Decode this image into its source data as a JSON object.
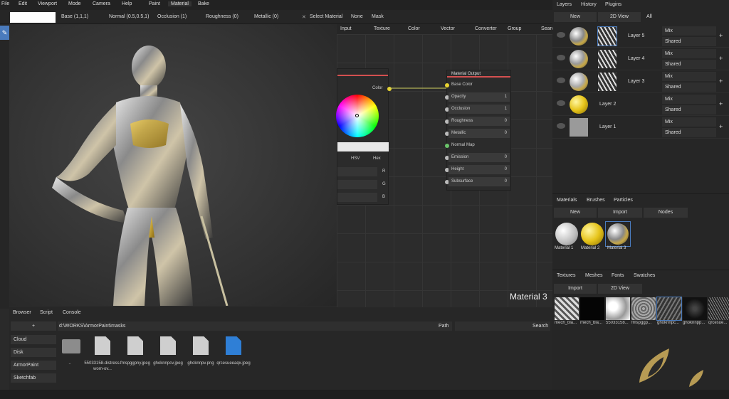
{
  "menu": {
    "items": [
      "File",
      "Edit",
      "Viewport",
      "Mode",
      "Camera",
      "Help"
    ],
    "tabs": [
      "Paint",
      "Material",
      "Bake"
    ]
  },
  "toolbar": {
    "base": "Base (1,1,1)",
    "normal": "Normal (0.5,0.5,1)",
    "occlusion": "Occlusion (1)",
    "roughness": "Roughness (0)",
    "metallic": "Metallic (0)",
    "select_material": "Select Material",
    "none": "None",
    "mask": "Mask"
  },
  "node_menu": [
    "Input",
    "Texture",
    "Color",
    "Vector",
    "Converter",
    "Group",
    "Search"
  ],
  "picker": {
    "color_label": "Color",
    "hsv": "HSV",
    "hex": "Hex",
    "r": "R",
    "g": "G",
    "b": "B"
  },
  "material_output": {
    "title": "Material Output",
    "rows": [
      {
        "label": "Base Color",
        "value": ""
      },
      {
        "label": "Opacity",
        "value": "1"
      },
      {
        "label": "Occlusion",
        "value": "1"
      },
      {
        "label": "Roughness",
        "value": "0"
      },
      {
        "label": "Metallic",
        "value": "0"
      },
      {
        "label": "Normal Map",
        "value": ""
      },
      {
        "label": "Emission",
        "value": "0"
      },
      {
        "label": "Height",
        "value": "0"
      },
      {
        "label": "Subsurface",
        "value": "0"
      }
    ]
  },
  "viewport_label": "Material 3",
  "layers_panel": {
    "tabs": [
      "Layers",
      "History",
      "Plugins"
    ],
    "buttons": {
      "new": "New",
      "view2d": "2D View",
      "all": "All"
    },
    "layers": [
      {
        "name": "Layer 5",
        "mode": "Mix",
        "shared": "Shared"
      },
      {
        "name": "Layer 4",
        "mode": "Mix",
        "shared": "Shared"
      },
      {
        "name": "Layer 3",
        "mode": "Mix",
        "shared": "Shared"
      },
      {
        "name": "Layer 2",
        "mode": "Mix",
        "shared": "Shared"
      },
      {
        "name": "Layer 1",
        "mode": "Mix",
        "shared": "Shared"
      }
    ]
  },
  "materials_panel": {
    "tabs": [
      "Materials",
      "Brushes",
      "Particles"
    ],
    "buttons": {
      "new": "New",
      "import": "Import",
      "nodes": "Nodes"
    },
    "items": [
      "Material 1",
      "Material 2",
      "Material 3"
    ]
  },
  "textures_panel": {
    "tabs": [
      "Textures",
      "Meshes",
      "Fonts",
      "Swatches"
    ],
    "buttons": {
      "import": "Import",
      "view2d": "2D View"
    },
    "items": [
      "mech_bla...",
      "mech_bla...",
      "55033158...",
      "fmspggp...",
      "ghoknnpc...",
      "ghoknnpp...",
      "qrcesue..."
    ]
  },
  "browser": {
    "tabs": [
      "Browser",
      "Script",
      "Console"
    ],
    "add": "+",
    "sources": [
      "Cloud",
      "Disk",
      "ArmorPaint",
      "Sketchfab"
    ],
    "path": "d:\\WORKS\\ArmorPaint\\masks",
    "path_label": "Path",
    "search_label": "Search",
    "files": [
      {
        "name": "..",
        "type": "folder"
      },
      {
        "name": "55033158-distress-worn-ov...",
        "type": "file"
      },
      {
        "name": "fmspggpny.jpeg",
        "type": "file"
      },
      {
        "name": "ghoknnpcv.jpeg",
        "type": "file"
      },
      {
        "name": "ghoknnpv.png",
        "type": "file"
      },
      {
        "name": "qrcesueeaqx.jpeg",
        "type": "file-selected"
      }
    ]
  }
}
